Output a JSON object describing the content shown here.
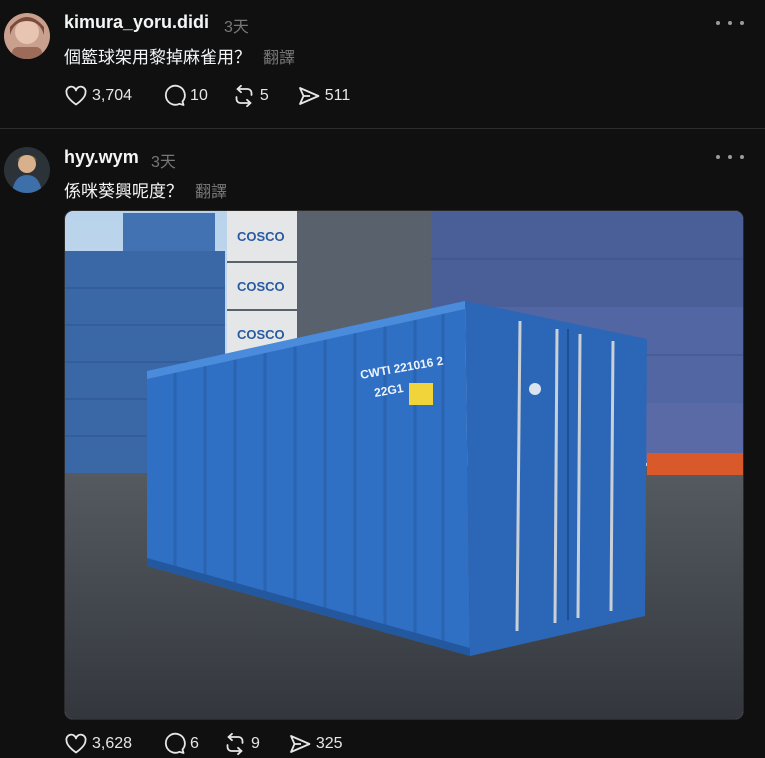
{
  "posts": [
    {
      "username": "kimura_yoru.didi",
      "time": "3天",
      "text": "個籃球架用黎掉麻雀用？",
      "translate": "翻譯",
      "likes": "3,704",
      "comments": "10",
      "reposts": "5",
      "shares": "511"
    },
    {
      "username": "hyy.wym",
      "time": "3天",
      "text": "係咪葵興呢度？",
      "translate": "翻譯",
      "image_text": {
        "brand": "COSCO",
        "container_code": "CWTI 221016 2",
        "type_code": "22G1"
      },
      "likes": "3,628",
      "comments": "6",
      "reposts": "9",
      "shares": "325"
    }
  ],
  "icons": {
    "like": "heart-icon",
    "comment": "comment-bubble-icon",
    "repost": "repost-icon",
    "share": "send-icon",
    "more": "more-dots-icon"
  },
  "colors": {
    "background": "#101010",
    "text": "#f3f5f7",
    "muted": "#777777",
    "container_blue": "#2f6fc4"
  }
}
